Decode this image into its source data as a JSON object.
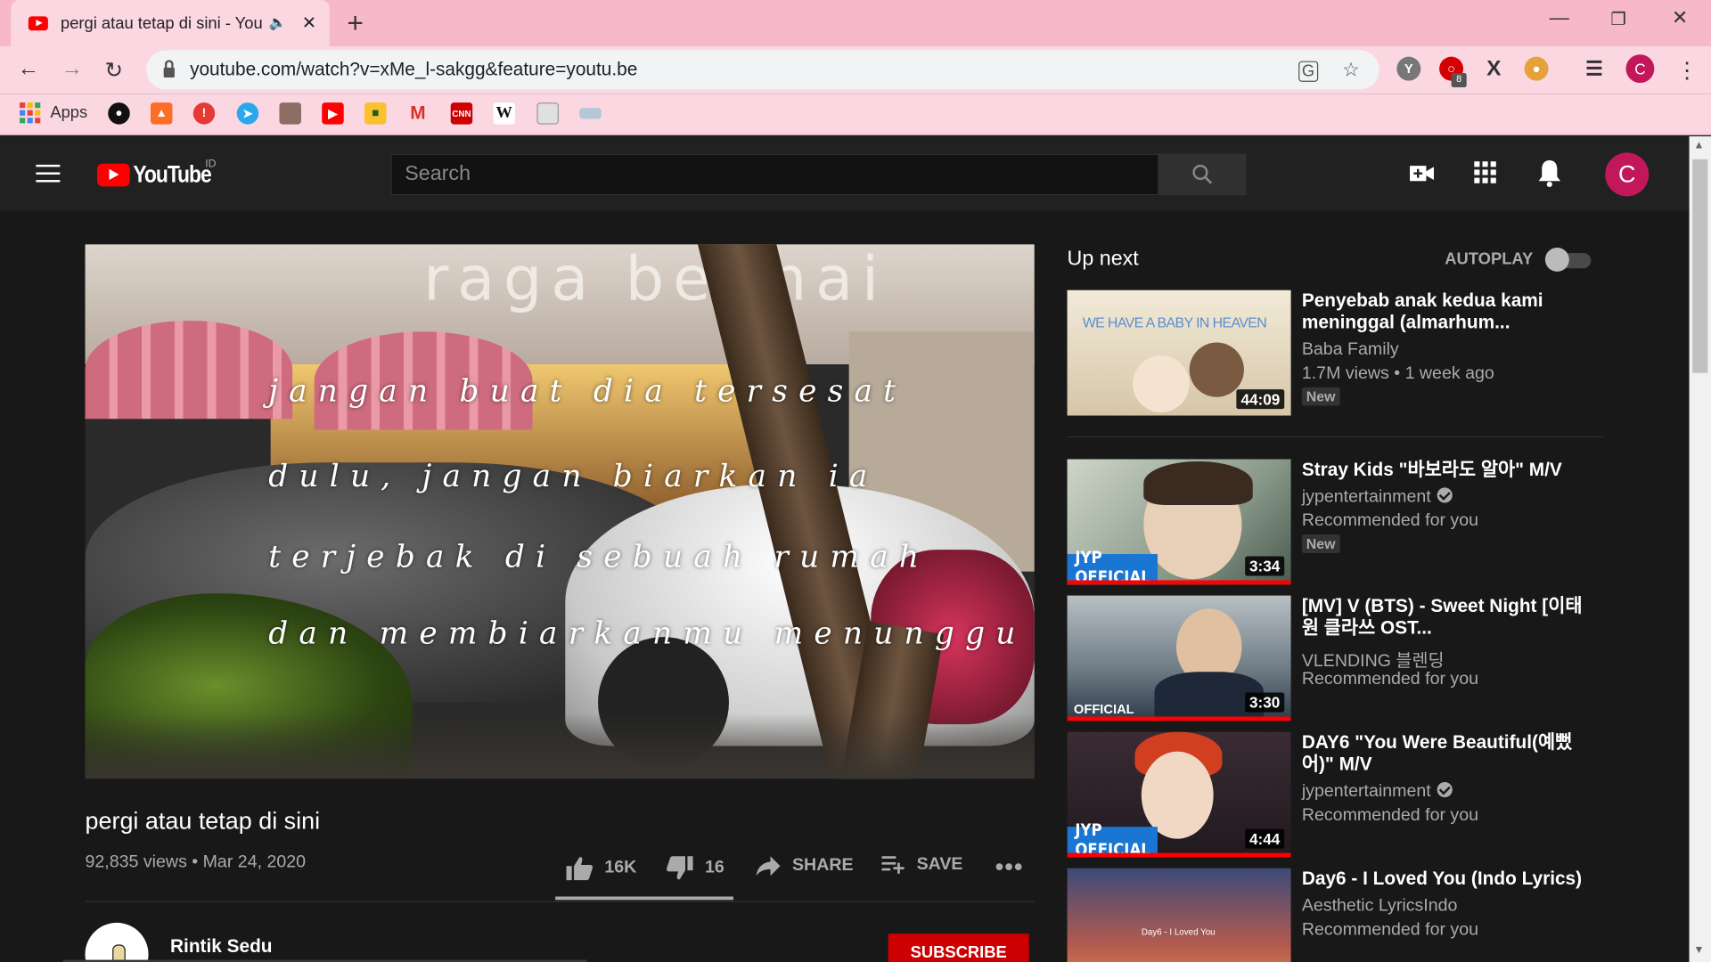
{
  "browser": {
    "tab_title": "pergi atau tetap di sini - YouTube",
    "url": "youtube.com/watch?v=xMe_l-sakgg&feature=youtu.be",
    "apps_label": "Apps",
    "profile_initial": "C",
    "extension_badge": "8"
  },
  "masthead": {
    "logo_text": "YouTube",
    "region": "ID",
    "search_placeholder": "Search",
    "avatar_initial": "C"
  },
  "player": {
    "sign_text": "raga be mai",
    "lyrics": [
      "jangan buat dia tersesat",
      "dulu, jangan biarkan ia",
      "terjebak di sebuah rumah",
      "dan membiarkanmu menunggu"
    ]
  },
  "video": {
    "title": "pergi atau tetap di sini",
    "meta": "92,835 views • Mar 24, 2020",
    "likes": "16K",
    "dislikes": "16",
    "like_ratio": 0.999,
    "share_label": "SHARE",
    "save_label": "SAVE",
    "channel": "Rintik Sedu",
    "subscribe_label": "SUBSCRIBE"
  },
  "up_next": {
    "label": "Up next",
    "autoplay_label": "AUTOPLAY",
    "autoplay_on": false,
    "items": [
      {
        "title": "Penyebab anak kedua kami meninggal (almarhum...",
        "channel": "Baba Family",
        "sub": "1.7M views • 1 week ago",
        "badge": "New",
        "duration": "44:09",
        "thumb_text": "WE HAVE A BABY IN HEAVEN"
      },
      {
        "title": "Stray Kids \"바보라도 알아\" M/V",
        "channel": "jypentertainment",
        "sub": "Recommended for you",
        "badge": "New",
        "duration": "3:34",
        "thumb_text": "JYP OFFICIAL"
      },
      {
        "title": "[MV] V (BTS) - Sweet Night [이태원 클라쓰 OST...",
        "channel": "VLENDING 블렌딩",
        "sub": "Recommended for you",
        "duration": "3:30",
        "thumb_text": "OFFICIAL"
      },
      {
        "title": "DAY6 \"You Were Beautiful(예뻤어)\" M/V",
        "channel": "jypentertainment",
        "sub": "Recommended for you",
        "duration": "4:44",
        "thumb_text": "JYP OFFICIAL"
      },
      {
        "title": "Day6 - I Loved You (Indo Lyrics)",
        "channel": "Aesthetic LyricsIndo",
        "sub": "Recommended for you",
        "thumb_text": "Day6 - I Loved You"
      }
    ]
  },
  "colors": {
    "yt_background": "#181818",
    "masthead": "#212121",
    "brand_red": "#ff0000",
    "subscribe_red": "#cc0000",
    "chrome_pink": "#f7b8c9",
    "jyp_blue": "#1976d2"
  }
}
